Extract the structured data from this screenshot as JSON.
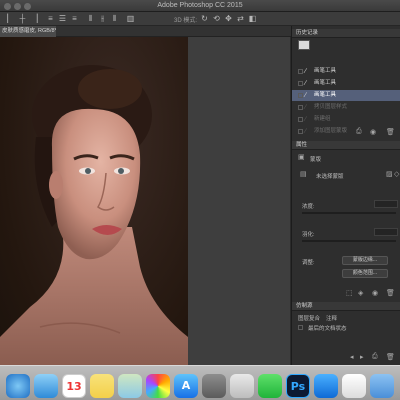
{
  "window": {
    "title": "Adobe Photoshop CC 2015"
  },
  "options_bar": {
    "mode_label": "3D 模式:"
  },
  "document": {
    "tab_label": "皮肤质感磨皮, RGB/8*) *"
  },
  "history_panel": {
    "title": "历史记录",
    "items": [
      {
        "label": "画笔工具",
        "state": "normal"
      },
      {
        "label": "画笔工具",
        "state": "normal"
      },
      {
        "label": "画笔工具",
        "state": "active"
      },
      {
        "label": "拷贝图层样式",
        "state": "disabled"
      },
      {
        "label": "新建组",
        "state": "disabled"
      },
      {
        "label": "添加图层蒙版",
        "state": "disabled"
      }
    ]
  },
  "properties_panel": {
    "title": "属性",
    "section_label": "蒙版",
    "mask_label": "未选择蒙版",
    "density_label": "浓度:",
    "feather_label": "羽化:",
    "refine_label": "调整:",
    "edge_button": "蒙版边缘...",
    "color_range_button": "颜色范围..."
  },
  "actions_panel": {
    "title": "仿制源",
    "tabs": [
      "图层复合",
      "注释"
    ],
    "item": "最后的文档状态"
  },
  "dock": {
    "icons": [
      {
        "name": "safari-icon",
        "label": ""
      },
      {
        "name": "mail-icon",
        "label": ""
      },
      {
        "name": "calendar-icon",
        "label": "13"
      },
      {
        "name": "notes-icon",
        "label": ""
      },
      {
        "name": "maps-icon",
        "label": ""
      },
      {
        "name": "photos-icon",
        "label": ""
      },
      {
        "name": "app-store-icon",
        "label": "A"
      },
      {
        "name": "system-preferences-icon",
        "label": ""
      },
      {
        "name": "preview-icon",
        "label": ""
      },
      {
        "name": "wechat-icon",
        "label": ""
      },
      {
        "name": "photoshop-icon",
        "label": "Ps"
      },
      {
        "name": "teamviewer-icon",
        "label": ""
      },
      {
        "name": "document-icon",
        "label": ""
      },
      {
        "name": "folder-icon",
        "label": ""
      }
    ]
  }
}
